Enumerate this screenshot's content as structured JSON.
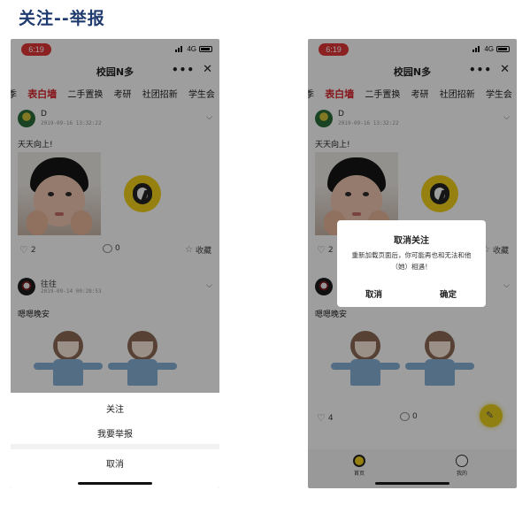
{
  "heading": "关注--举报",
  "status": {
    "time": "6:19",
    "network": "4G"
  },
  "nav": {
    "title": "校园N多",
    "more": "•••",
    "close": "✕"
  },
  "tabs": [
    "季",
    "表白墙",
    "二手置换",
    "考研",
    "社团招新",
    "学生会"
  ],
  "posts": [
    {
      "name": "D",
      "time": "2019-09-16 13:32:22",
      "text": "天天向上!",
      "likes": "2",
      "comments": "0",
      "favorite": "收藏"
    },
    {
      "name": "往往",
      "time": "2019-09-14 00:28:53",
      "text": "嗯嗯晚安"
    }
  ],
  "sheet": {
    "follow": "关注",
    "report": "我要举报",
    "cancel": "取消"
  },
  "dialog": {
    "title": "取消关注",
    "body": "重新加载页面后，你可能再也和无法和他（她）相遇！",
    "cancel": "取消",
    "confirm": "确定"
  },
  "right_actions": {
    "likes": "4",
    "comments": "0",
    "favorite": "藏"
  },
  "tabbar": {
    "home": "首页",
    "mine": "我的"
  },
  "colors": {
    "accent": "#d8242b",
    "brand_yellow": "#f2d11b",
    "heading": "#1f3a6e"
  }
}
